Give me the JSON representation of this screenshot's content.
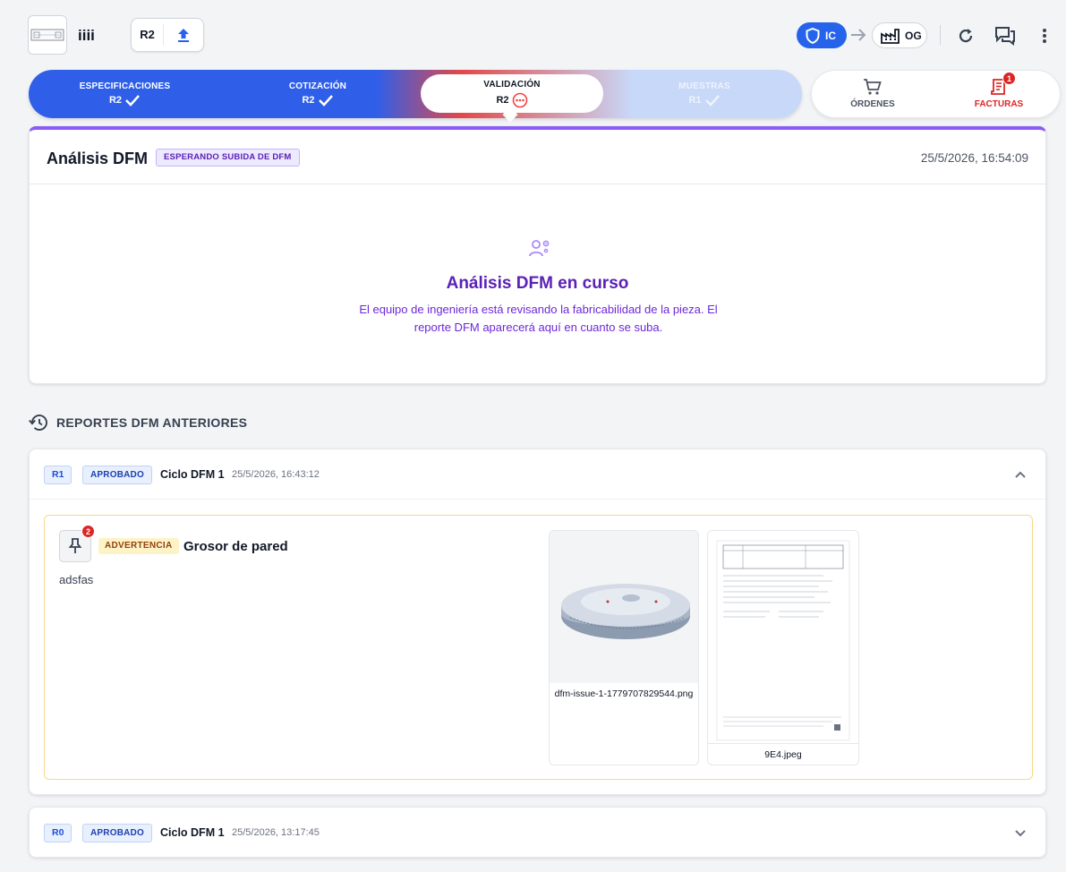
{
  "header": {
    "part_name": "iiii",
    "revision": "R2",
    "flow_from": "IC",
    "flow_to": "OG"
  },
  "stepper": {
    "steps": [
      {
        "label": "ESPECIFICACIONES",
        "rev": "R2",
        "status": "done"
      },
      {
        "label": "COTIZACIÓN",
        "rev": "R2",
        "status": "done"
      },
      {
        "label": "VALIDACIÓN",
        "rev": "R2",
        "status": "in-progress"
      },
      {
        "label": "MUESTRAS",
        "rev": "R1",
        "status": "done"
      }
    ],
    "orders_label": "ÓRDENES",
    "invoices_label": "FACTURAS",
    "invoices_badge": "1"
  },
  "dfm": {
    "title": "Análisis DFM",
    "status": "ESPERANDO SUBIDA DE DFM",
    "date": "25/5/2026, 16:54:09",
    "message_title": "Análisis DFM en curso",
    "message_text": "El equipo de ingeniería está revisando la fabricabilidad de la pieza. El reporte DFM aparecerá aquí en cuanto se suba."
  },
  "history": {
    "title": "REPORTES DFM ANTERIORES",
    "reports": [
      {
        "rev": "R1",
        "status": "APROBADO",
        "cycle": "Ciclo DFM 1",
        "date": "25/5/2026, 16:43:12",
        "expanded": true,
        "issue": {
          "pin_count": "2",
          "severity": "ADVERTENCIA",
          "title": "Grosor de pared",
          "description": "adsfas",
          "attachments": [
            {
              "name": "dfm-issue-1-1779707829544.png"
            },
            {
              "name": "9E4.jpeg"
            }
          ]
        }
      },
      {
        "rev": "R0",
        "status": "APROBADO",
        "cycle": "Ciclo DFM 1",
        "date": "25/5/2026, 13:17:45",
        "expanded": false
      }
    ]
  },
  "colors": {
    "primary": "#2563eb",
    "accent_purple": "#8b5cf6",
    "danger": "#dc2626",
    "warning_border": "#f5d98a"
  }
}
